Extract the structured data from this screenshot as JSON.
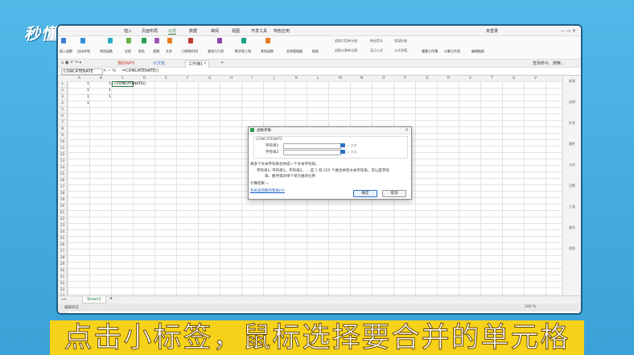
{
  "overlay": {
    "logo": "秒懂视频",
    "subtitle": "点击小标签，鼠标选择要合并的单元格"
  },
  "menu": {
    "items": [
      "插入",
      "页面布局",
      "公式",
      "数据",
      "审阅",
      "视图",
      "开发工具",
      "特色应用"
    ],
    "active": "公式",
    "right": "未登录"
  },
  "ribbon": {
    "groups": [
      "插入函数",
      "自动求和",
      "常用函数",
      "全部",
      "财务",
      "逻辑",
      "文本",
      "日期和时间",
      "查找与引用",
      "数学和三角",
      "其他函数",
      "名称管理器",
      "粘贴",
      "追踪引用单元格",
      "追踪从属单元格",
      "移去箭头",
      "显示公式",
      "错误检查",
      "公式求值",
      "重算工作簿",
      "计算工作表",
      "编辑链接"
    ]
  },
  "tabs": {
    "wps": "我的WPS",
    "template": "公文包",
    "doc": "工作簿1 *",
    "search": "查找命令、搜索..."
  },
  "formula_bar": {
    "name_box": "CONCATENATE",
    "formula": "=CONCATENATE()"
  },
  "grid": {
    "columns": [
      "A",
      "B",
      "C",
      "D",
      "E",
      "F",
      "G",
      "H",
      "I",
      "J",
      "K",
      "L",
      "M",
      "N",
      "O",
      "P",
      "Q",
      "R",
      "S",
      "T",
      "U",
      "V"
    ],
    "rows": [
      "1",
      "2",
      "3",
      "4",
      "5",
      "6",
      "7",
      "8",
      "9",
      "10",
      "11",
      "12",
      "13",
      "14",
      "15",
      "16",
      "17",
      "18",
      "19",
      "20",
      "21",
      "22",
      "23",
      "24",
      "25",
      "26",
      "27",
      "28",
      "29",
      "30",
      "31",
      "32",
      "33",
      "34",
      "35",
      "36"
    ],
    "cells": {
      "A1": "1",
      "B1": "1",
      "A2": "1",
      "B2": "1",
      "A3": "1",
      "B3": "1",
      "A4": "1",
      "C1": "=CONCATENATE()"
    }
  },
  "right_panel": [
    "新建",
    "选择",
    "形状",
    "属性",
    "分析",
    "设置",
    "工具",
    "备份",
    "帮助"
  ],
  "sheet": {
    "tab": "Sheet1",
    "add": "+",
    "status_left": "编辑状态",
    "zoom": "100 %"
  },
  "dialog": {
    "title": "函数参数",
    "function_name": "CONCATENATE",
    "field1_label": "字符串1",
    "field2_label": "字符串2",
    "field_hint": "= 文本",
    "desc1": "将多个文本字符串合并成一个文本字符串。",
    "desc2": "字符串1: 字符串1，字符串2，... 是 1 到 255 个要合并的文本字符串。可以是字符",
    "desc3": "串、数字或对单个单元格的引用",
    "result": "计算结果 =",
    "help_link": "有关该函数的帮助(H)",
    "ok": "确定",
    "cancel": "取消"
  }
}
